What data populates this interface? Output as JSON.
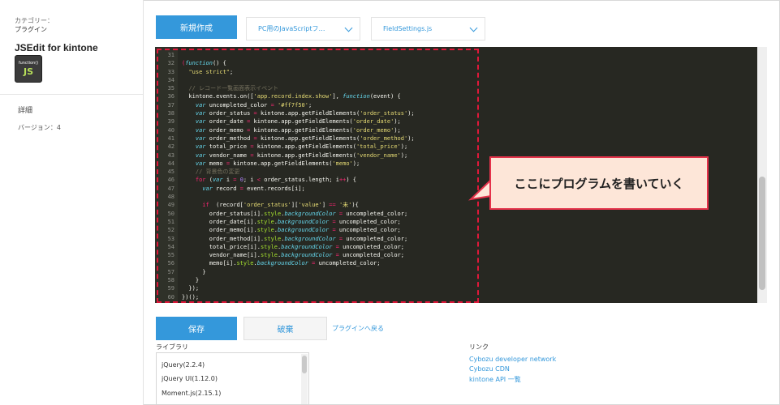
{
  "sidebar": {
    "category_label": "カテゴリー：",
    "category_value": "プラグイン",
    "plugin_name": "JSEdit for kintone",
    "icon_text_top": "function()",
    "icon_text_main": "JS",
    "detail_label": "詳細",
    "version": "バージョン：4"
  },
  "toolbar": {
    "new_button": "新規作成",
    "js_select": "PC用のJavaScriptフ…",
    "file_select": "FieldSettings.js"
  },
  "editor": {
    "lines": [
      {
        "n": "31",
        "html": ""
      },
      {
        "n": "32",
        "html": "<span class=\"op\">(</span><span class=\"kw\">function</span>() {"
      },
      {
        "n": "33",
        "html": "  <span class=\"str\">\"use strict\"</span>;"
      },
      {
        "n": "34",
        "html": ""
      },
      {
        "n": "35",
        "html": "  <span class=\"cm\">// レコード一覧画面表示イベント</span>"
      },
      {
        "n": "36",
        "html": "  kintone.events.on([<span class=\"str\">'app.record.index.show'</span>], <span class=\"kw\">function</span>(event) {"
      },
      {
        "n": "37",
        "html": "    <span class=\"kw\">var</span> uncompleted_color <span class=\"op\">=</span> <span class=\"str\">'#ff7f50'</span>;"
      },
      {
        "n": "38",
        "html": "    <span class=\"kw\">var</span> order_status <span class=\"op\">=</span> kintone.app.getFieldElements(<span class=\"str\">'order_status'</span>);"
      },
      {
        "n": "39",
        "html": "    <span class=\"kw\">var</span> order_date <span class=\"op\">=</span> kintone.app.getFieldElements(<span class=\"str\">'order_date'</span>);"
      },
      {
        "n": "40",
        "html": "    <span class=\"kw\">var</span> order_memo <span class=\"op\">=</span> kintone.app.getFieldElements(<span class=\"str\">'order_memo'</span>);"
      },
      {
        "n": "41",
        "html": "    <span class=\"kw\">var</span> order_method <span class=\"op\">=</span> kintone.app.getFieldElements(<span class=\"str\">'order_method'</span>);"
      },
      {
        "n": "42",
        "html": "    <span class=\"kw\">var</span> total_price <span class=\"op\">=</span> kintone.app.getFieldElements(<span class=\"str\">'total_price'</span>);"
      },
      {
        "n": "43",
        "html": "    <span class=\"kw\">var</span> vendor_name <span class=\"op\">=</span> kintone.app.getFieldElements(<span class=\"str\">'vendor_name'</span>);"
      },
      {
        "n": "44",
        "html": "    <span class=\"kw\">var</span> memo <span class=\"op\">=</span> kintone.app.getFieldElements(<span class=\"str\">'memo'</span>);"
      },
      {
        "n": "45",
        "html": "    <span class=\"cm\">// 背景色の変更</span>"
      },
      {
        "n": "46",
        "html": "    <span class=\"op\">for</span> (<span class=\"kw\">var</span> i <span class=\"op\">=</span> <span class=\"num\">0</span>; i <span class=\"op\">&lt;</span> order_status.length; i<span class=\"op\">++</span>) {"
      },
      {
        "n": "47",
        "html": "      <span class=\"kw\">var</span> record <span class=\"op\">=</span> event.records[i];"
      },
      {
        "n": "48",
        "html": ""
      },
      {
        "n": "49",
        "html": "      <span class=\"op\">if</span>  (record[<span class=\"str\">'order_status'</span>][<span class=\"str\">'value'</span>] <span class=\"op\">==</span> <span class=\"str\">'未'</span>){"
      },
      {
        "n": "50",
        "html": "        order_status[i].<span class=\"fn\">style</span>.<span class=\"kw\">backgroundColor</span> <span class=\"op\">=</span> uncompleted_color;"
      },
      {
        "n": "51",
        "html": "        order_date[i].<span class=\"fn\">style</span>.<span class=\"kw\">backgroundColor</span> <span class=\"op\">=</span> uncompleted_color;"
      },
      {
        "n": "52",
        "html": "        order_memo[i].<span class=\"fn\">style</span>.<span class=\"kw\">backgroundColor</span> <span class=\"op\">=</span> uncompleted_color;"
      },
      {
        "n": "53",
        "html": "        order_method[i].<span class=\"fn\">style</span>.<span class=\"kw\">backgroundColor</span> <span class=\"op\">=</span> uncompleted_color;"
      },
      {
        "n": "54",
        "html": "        total_price[i].<span class=\"fn\">style</span>.<span class=\"kw\">backgroundColor</span> <span class=\"op\">=</span> uncompleted_color;"
      },
      {
        "n": "55",
        "html": "        vendor_name[i].<span class=\"fn\">style</span>.<span class=\"kw\">backgroundColor</span> <span class=\"op\">=</span> uncompleted_color;"
      },
      {
        "n": "56",
        "html": "        memo[i].<span class=\"fn\">style</span>.<span class=\"kw\">backgroundColor</span> <span class=\"op\">=</span> uncompleted_color;"
      },
      {
        "n": "57",
        "html": "      }"
      },
      {
        "n": "58",
        "html": "    }"
      },
      {
        "n": "59",
        "html": "  });"
      },
      {
        "n": "60",
        "html": "})();"
      },
      {
        "n": "61",
        "html": ""
      }
    ]
  },
  "callout": {
    "text": "ここにプログラムを書いていく",
    "border_color": "#e5334b",
    "fill_color": "#fde6d8"
  },
  "actions": {
    "save_button": "保存",
    "discard_button": "破棄",
    "back_link": "プラグインへ戻る"
  },
  "library": {
    "label": "ライブラリ",
    "items": [
      "jQuery(2.2.4)",
      "jQuery UI(1.12.0)",
      "Moment.js(2.15.1)"
    ]
  },
  "links": {
    "label": "リンク",
    "items": [
      "Cybozu developer network",
      "Cybozu CDN",
      "kintone API 一覧"
    ]
  },
  "colors": {
    "accent": "#3498db",
    "editor_bg": "#272822",
    "highlight": "#e0183a"
  }
}
